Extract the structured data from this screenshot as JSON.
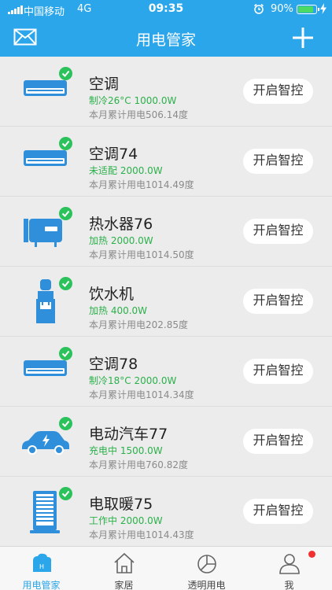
{
  "status_bar": {
    "carrier": "中国移动",
    "network": "4G",
    "time": "09:35",
    "battery": "90%",
    "battery_level": 0.9,
    "icons": [
      "signal-icon",
      "alarm-icon",
      "battery-icon",
      "charging-bolt-icon"
    ]
  },
  "header": {
    "title": "用电管家",
    "left_icon": "mail-icon",
    "right_icon": "plus-icon"
  },
  "devices": [
    {
      "name": "空调",
      "state": "制冷26°C 1000.0W",
      "monthly": "本月累计用电506.14度",
      "button": "开启智控",
      "icon": "air-conditioner-icon"
    },
    {
      "name": "空调74",
      "state": "未适配 2000.0W",
      "monthly": "本月累计用电1014.49度",
      "button": "开启智控",
      "icon": "air-conditioner-icon"
    },
    {
      "name": "热水器76",
      "state": "加热 2000.0W",
      "monthly": "本月累计用电1014.50度",
      "button": "开启智控",
      "icon": "water-heater-icon"
    },
    {
      "name": "饮水机",
      "state": "加热 400.0W",
      "monthly": "本月累计用电202.85度",
      "button": "开启智控",
      "icon": "water-dispenser-icon"
    },
    {
      "name": "空调78",
      "state": "制冷18°C 2000.0W",
      "monthly": "本月累计用电1014.34度",
      "button": "开启智控",
      "icon": "air-conditioner-icon"
    },
    {
      "name": "电动汽车77",
      "state": "充电中 1500.0W",
      "monthly": "本月累计用电760.82度",
      "button": "开启智控",
      "icon": "electric-car-icon"
    },
    {
      "name": "电取暖75",
      "state": "工作中 2000.0W",
      "monthly": "本月累计用电1014.43度",
      "button": "开启智控",
      "icon": "electric-heater-icon"
    }
  ],
  "tabs": [
    {
      "label": "用电管家",
      "icon": "power-manager-icon",
      "active": true
    },
    {
      "label": "家居",
      "icon": "home-icon",
      "active": false
    },
    {
      "label": "透明用电",
      "icon": "pie-chart-icon",
      "active": false
    },
    {
      "label": "我",
      "icon": "user-icon",
      "active": false,
      "badge": true
    }
  ],
  "colors": {
    "accent": "#2ba6ea",
    "status_green": "#2bb04a",
    "badge_red": "#f23030"
  }
}
